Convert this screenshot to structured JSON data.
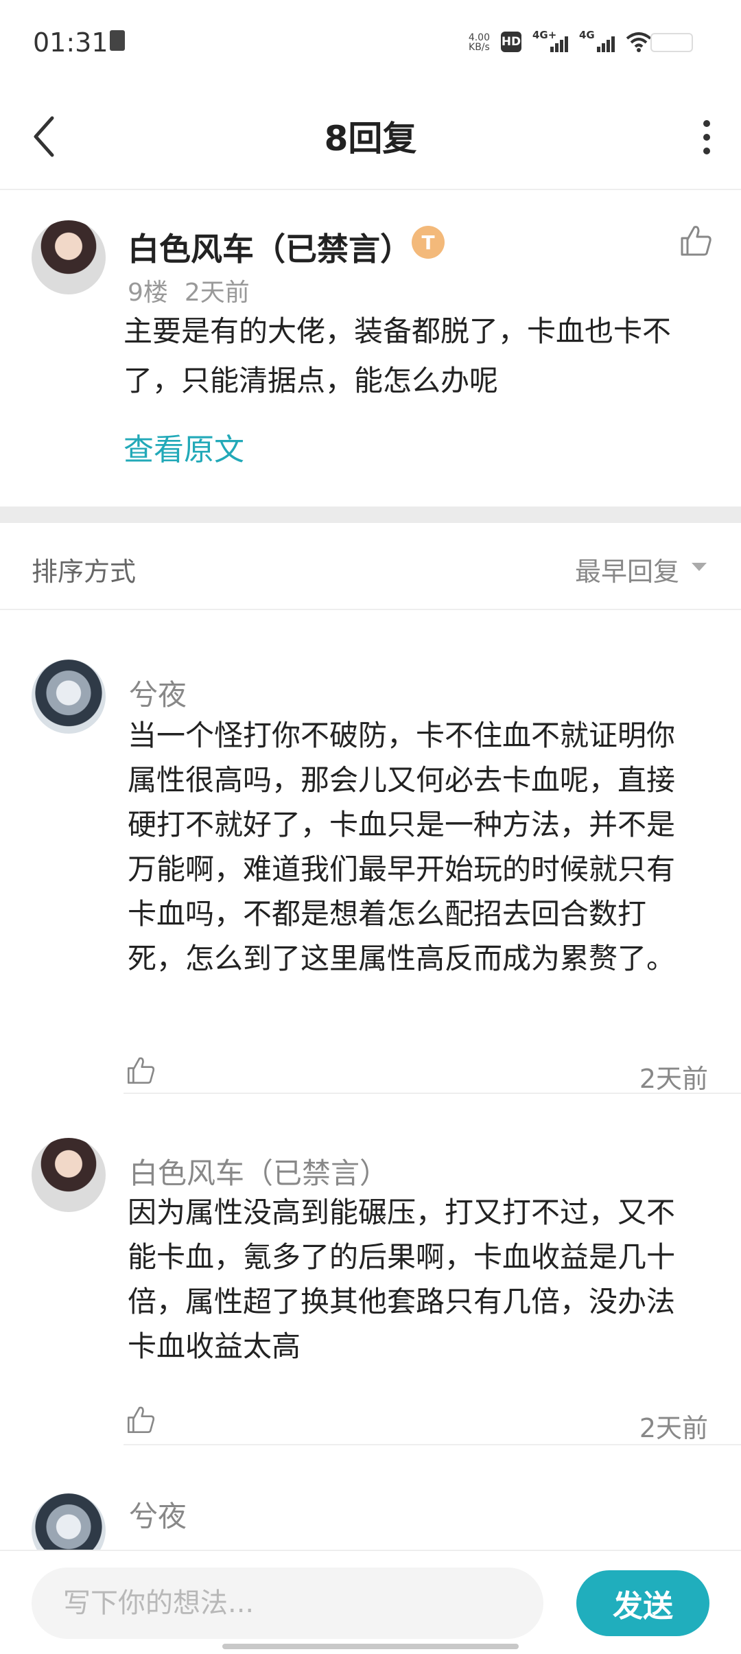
{
  "status_bar": {
    "time": "01:31",
    "net_speed_value": "4.00",
    "net_speed_unit": "KB/s",
    "hd_label": "HD",
    "sim1_label": "4G+",
    "sim2_label": "4G"
  },
  "header": {
    "title": "8回复"
  },
  "post": {
    "author": "白色风车（已禁言）",
    "badge": "T",
    "floor": "9楼",
    "time": "2天前",
    "content": "主要是有的大佬，装备都脱了，卡血也卡不了，只能清据点，能怎么办呢",
    "view_original": "查看原文"
  },
  "sort": {
    "label": "排序方式",
    "value": "最早回复"
  },
  "replies": [
    {
      "author": "兮夜",
      "content": "当一个怪打你不破防，卡不住血不就证明你属性很高吗，那会儿又何必去卡血呢，直接硬打不就好了，卡血只是一种方法，并不是万能啊，难道我们最早开始玩的时候就只有卡血吗，不都是想着怎么配招去回合数打死，怎么到了这里属性高反而成为累赘了。",
      "time": "2天前"
    },
    {
      "author": "白色风车（已禁言）",
      "content": "因为属性没高到能碾压，打又打不过，又不能卡血，氪多了的后果啊，卡血收益是几十倍，属性超了换其他套路只有几倍，没办法卡血收益太高",
      "time": "2天前"
    },
    {
      "author": "兮夜"
    }
  ],
  "bottom_bar": {
    "input_placeholder": "写下你的想法...",
    "send_label": "发送"
  },
  "colors": {
    "accent": "#20aebd",
    "link": "#22a9b8"
  }
}
